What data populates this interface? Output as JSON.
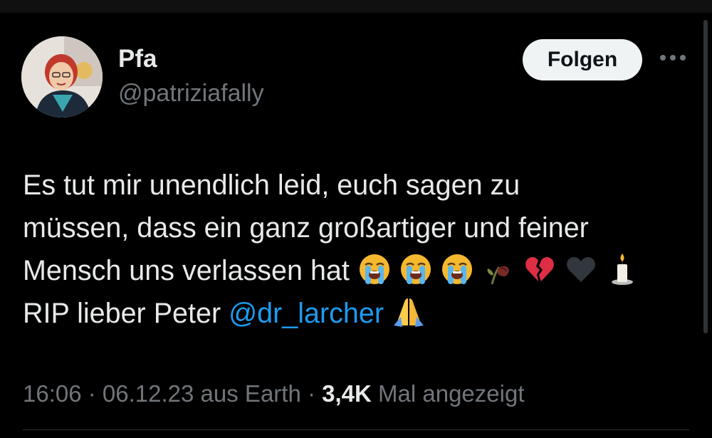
{
  "author": {
    "display_name": "Pfa",
    "handle": "@patriziafally"
  },
  "actions": {
    "follow_label": "Folgen",
    "more_icon": "more-horizontal-icon"
  },
  "tweet": {
    "line1": "Es tut mir unendlich leid, euch sagen zu",
    "line2": "müssen, dass ein ganz großartiger und feiner",
    "line3": "Mensch uns verlassen hat",
    "line4_text": "RIP lieber Peter ",
    "mention": "@dr_larcher",
    "emojis_line3": [
      "loudly-crying-face",
      "loudly-crying-face",
      "loudly-crying-face",
      "wilted-rose",
      "broken-heart",
      "black-heart",
      "candle"
    ],
    "emojis_line4": [
      "folded-hands"
    ]
  },
  "meta": {
    "time": "16:06",
    "sep1": " · ",
    "date": "06.12.23",
    "source": " aus Earth",
    "sep2": " · ",
    "views_count": "3,4K",
    "views_label": " Mal angezeigt"
  },
  "colors": {
    "background": "#000000",
    "text": "#e7e9ea",
    "secondary": "#71767b",
    "link": "#1d9bf0",
    "button_bg": "#eff3f4"
  }
}
